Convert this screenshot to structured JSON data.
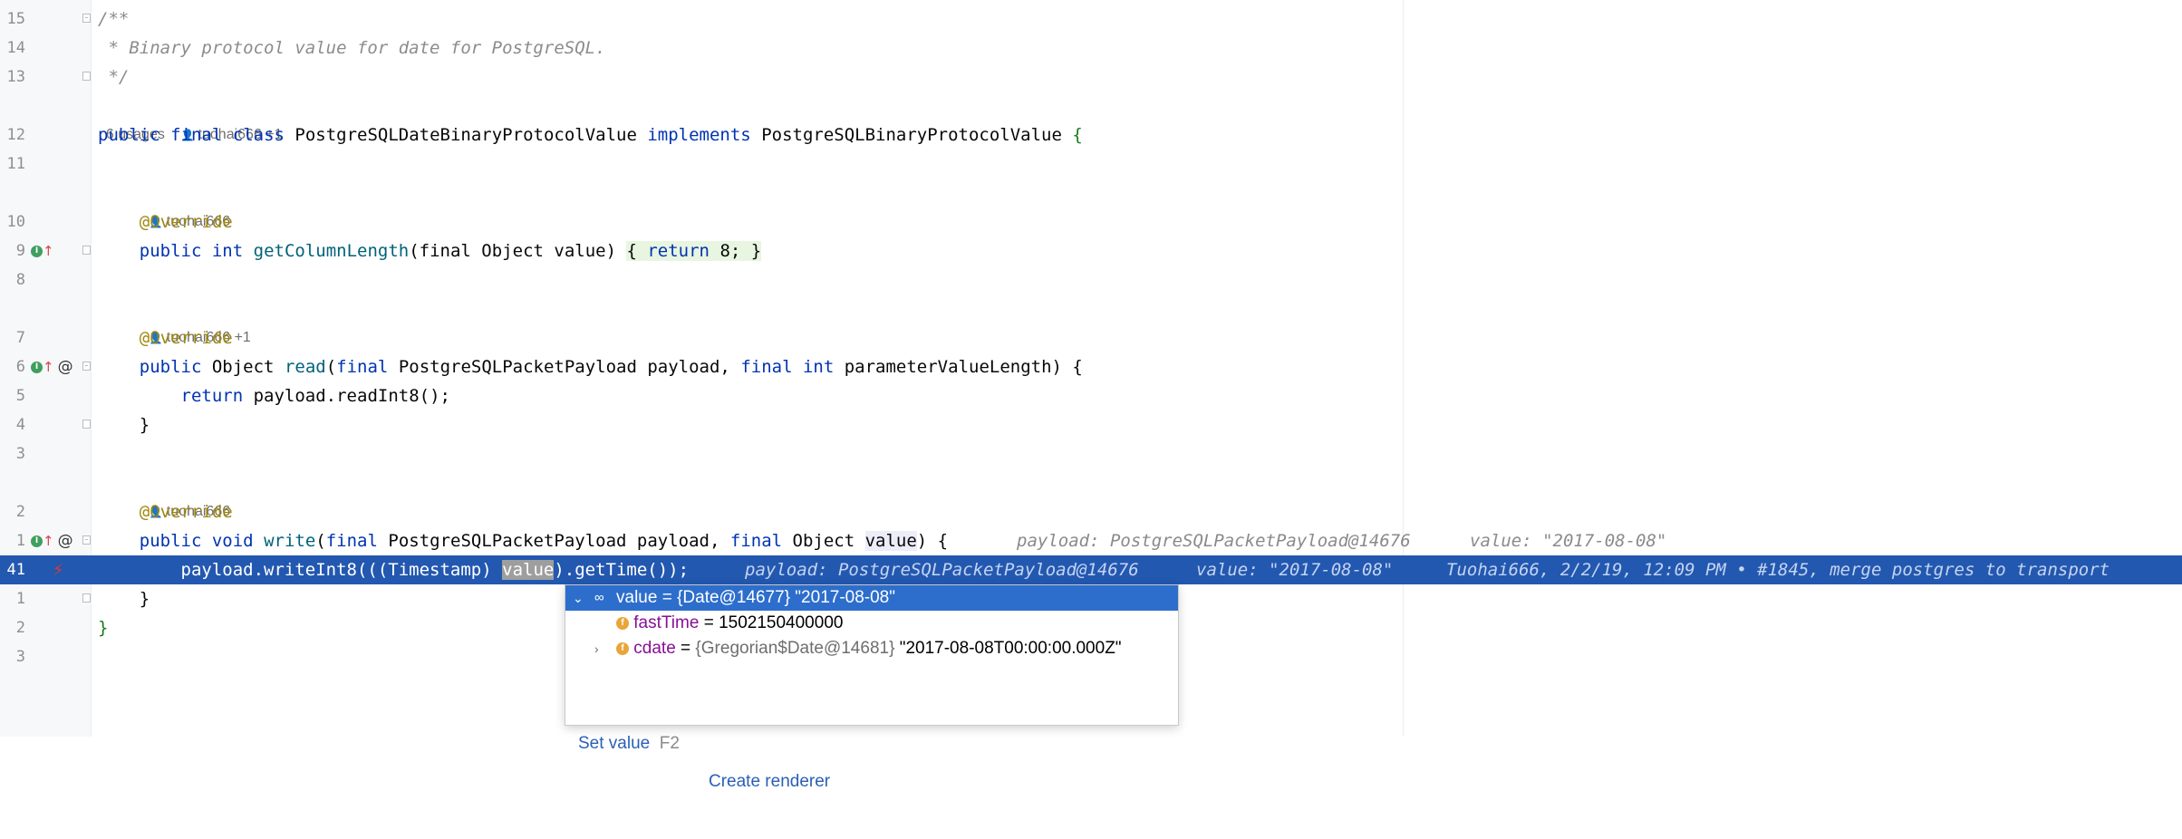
{
  "lines": [
    {
      "ln": "15",
      "text": "/**"
    },
    {
      "ln": "14",
      "text": " * Binary protocol value for date for PostgreSQL."
    },
    {
      "ln": "13",
      "text": " */"
    },
    {
      "ln": "12"
    },
    {
      "ln": "11"
    },
    {
      "ln": "10"
    },
    {
      "ln": "9"
    },
    {
      "ln": "8"
    },
    {
      "ln": "7"
    },
    {
      "ln": "6"
    },
    {
      "ln": "5"
    },
    {
      "ln": "4"
    },
    {
      "ln": "3"
    },
    {
      "ln": "2"
    },
    {
      "ln": "1"
    },
    {
      "ln": "41"
    },
    {
      "ln": "1"
    },
    {
      "ln": "2"
    },
    {
      "ln": "3"
    }
  ],
  "code": {
    "k_public": "public",
    "k_final": "final",
    "k_class": "class",
    "k_implements": "implements",
    "k_int": "int",
    "k_return": "return",
    "k_void": "void",
    "class_name": "PostgreSQLDateBinaryProtocolValue",
    "iface_name": "PostgreSQLBinaryProtocolValue",
    "open_brace": "{",
    "close_brace": "}",
    "override": "@Override",
    "m1": "getColumnLength",
    "m1_params": "(final Object value)",
    "m1_body_open": "{",
    "m1_body": " return 8; ",
    "m1_body_close": "}",
    "t_object": "Object",
    "m2": "read",
    "m2_params": "(final PostgreSQLPacketPayload payload, final int parameterValueLength) {",
    "m2_body": "return payload.readInt8();",
    "m3": "write",
    "m3_params": "(final PostgreSQLPacketPayload payload, final Object ",
    "m3_param_value": "value",
    "m3_params_end": ") {",
    "exec_prefix": "payload.writeInt8(((Timestamp) ",
    "exec_word": "value",
    "exec_suffix": ").getTime());"
  },
  "meta": {
    "usages": "6 usages",
    "author1": "tuohai666 +1",
    "author2": "tuohai666",
    "author3": "tuohai666 +1",
    "author4": "tuohai666"
  },
  "inlays": {
    "write_payload": "payload: PostgreSQLPacketPayload@14676",
    "write_value": "value: \"2017-08-08\"",
    "exec_payload": "payload: PostgreSQLPacketPayload@14676",
    "exec_value": "value: \"2017-08-08\"",
    "blame": "Tuohai666, 2/2/19, 12:09 PM • #1845, merge postgres to transport"
  },
  "popup": {
    "root": {
      "name": "value",
      "eq": " = ",
      "type": "{Date@14677}",
      "val": " \"2017-08-08\""
    },
    "children": [
      {
        "badge": "f",
        "name": "fastTime",
        "eq": " = ",
        "type": "",
        "val": "1502150400000"
      },
      {
        "badge": "f",
        "name": "cdate",
        "eq": " = ",
        "type": "{Gregorian$Date@14681}",
        "val": " \"2017-08-08T00:00:00.000Z\""
      }
    ],
    "set_value": "Set value",
    "set_value_shortcut": "F2",
    "create_renderer": "Create renderer"
  }
}
